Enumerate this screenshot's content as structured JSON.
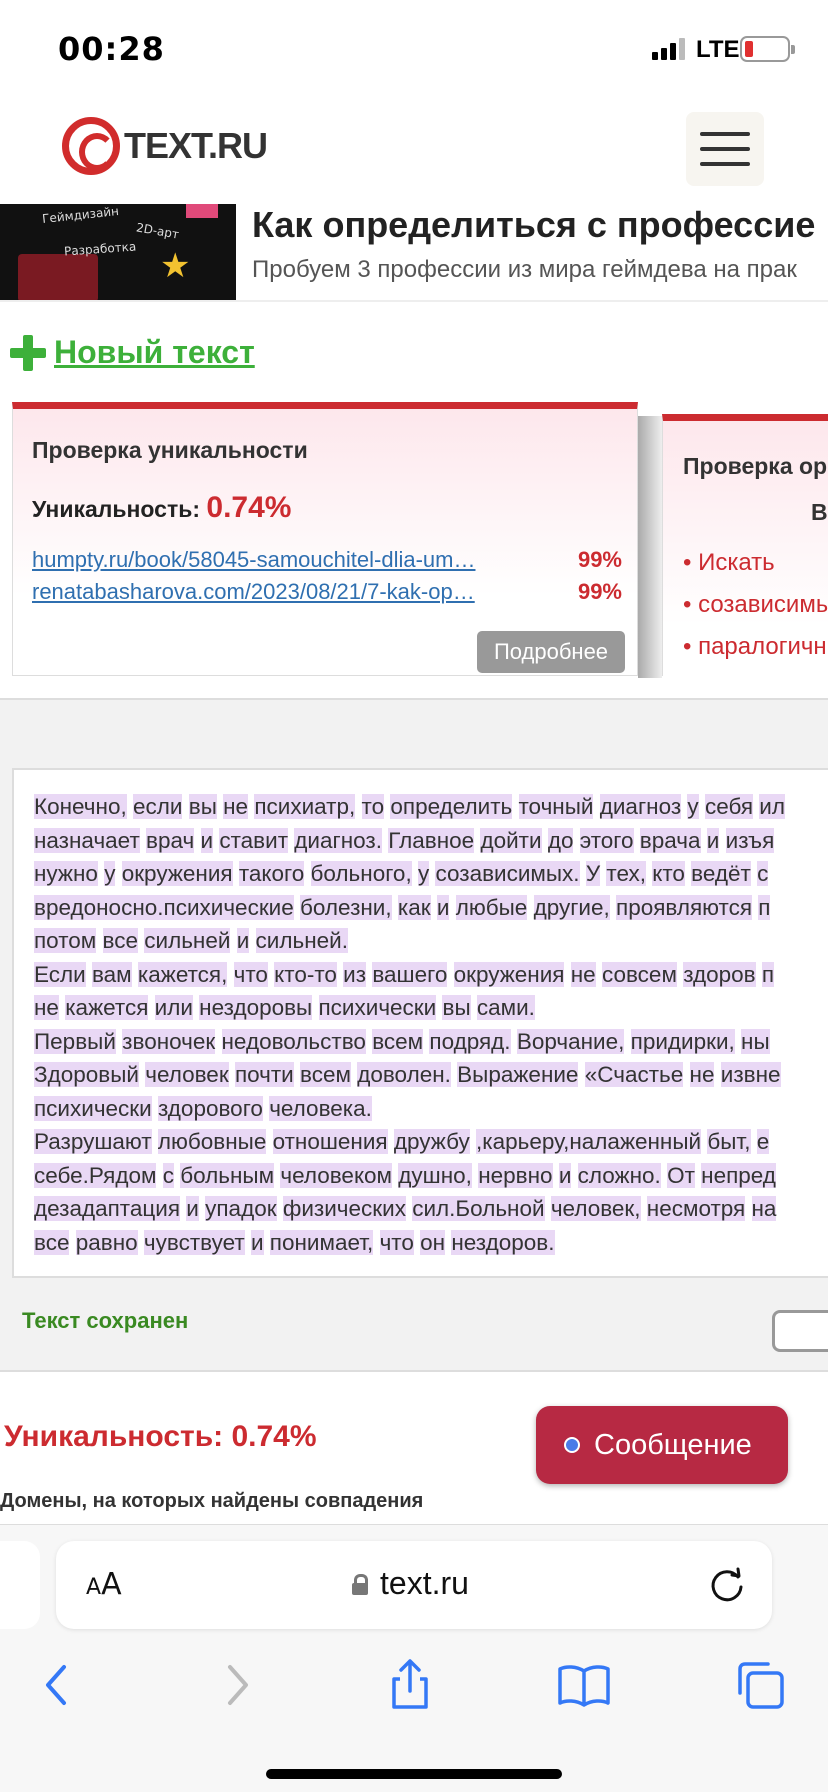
{
  "status_bar": {
    "time": "00:28",
    "network": "LTE"
  },
  "header": {
    "logo_text": "TEXT.RU"
  },
  "banner": {
    "image_labels": [
      "Геймдизайн",
      "2D-арт",
      "Разработка"
    ],
    "title": "Как определиться с профессие",
    "subtitle": "Пробуем 3 профессии из мира геймдева на прак"
  },
  "new_text_label": "Новый текст",
  "uniqueness_card": {
    "title": "Проверка уникальности",
    "uniqueness_label": "Уникальность:",
    "uniqueness_value": "0.74%",
    "links": [
      {
        "url": "humpty.ru/book/58045-samouchitel-dlia-um…",
        "percent": "99%"
      },
      {
        "url": "renatabasharova.com/2023/08/21/7-kak-op…",
        "percent": "99%"
      }
    ],
    "more_button": "Подробнее"
  },
  "second_card": {
    "title": "Проверка ор",
    "subtitle": "В",
    "items": [
      "• Искать",
      "• созависимы",
      "• паралогичн"
    ]
  },
  "text_lines": [
    "Конечно, если вы не психиатр, то определить точный диагноз у себя ил",
    "назначает врач и ставит диагноз. Главное дойти до этого врача и изъя",
    "нужно у окружения такого больного, у созависимых. У тех, кто ведёт с",
    "вредоносно.психические болезни, как и любые другие, проявляются п",
    "потом все сильней и сильней.",
    "Если вам кажется, что кто-то из вашего окружения не совсем здоров п",
    "не кажется или нездоровы психически вы сами.",
    "Первый звоночек недовольство всем подряд. Ворчание, придирки, ны",
    "Здоровый человек почти всем доволен. Выражение «Счастье не извне",
    "психически здорового человека.",
    "Разрушают любовные отношения дружбу ,карьеру,налаженный быт, е",
    "себе.Рядом с больным человеком душно, нервно и сложно. От непред",
    "дезадаптация и упадок физических сил.Больной человек, несмотря на",
    "все равно чувствует и понимает, что он нездоров."
  ],
  "saved_status": "Текст сохранен",
  "result": {
    "uniqueness": "Уникальность: 0.74%",
    "domains_heading": "Домены, на которых найдены совпадения"
  },
  "message_button": "Сообщение",
  "safari": {
    "text_size": "AA",
    "url": "text.ru"
  },
  "colors": {
    "accent_red": "#cc2b30",
    "green": "#3db03a",
    "highlight": "#e9d8f5",
    "link": "#2f6fb0",
    "message": "#b72943"
  }
}
